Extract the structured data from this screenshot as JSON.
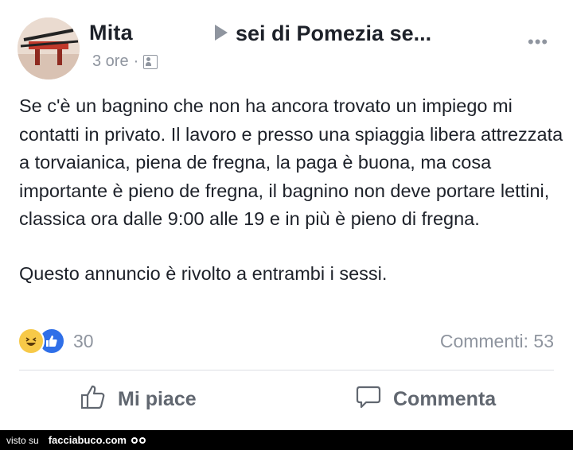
{
  "post": {
    "author": "Mita",
    "group": "sei di Pomezia se...",
    "time": "3 ore",
    "separator": "·",
    "audience_icon": "group-audience-icon",
    "more_label": "•••",
    "body_paragraphs": [
      "Se c'è un bagnino che non ha ancora trovato un impiego mi contatti in privato. Il lavoro e presso una spiaggia libera attrezzata a torvaianica, piena de fregna, la paga è buona, ma cosa importante è pieno de fregna, il bagnino non deve portare lettini,  classica ora dalle 9:00 alle 19 e in più è pieno di fregna.",
      "Questo annuncio è rivolto a entrambi i sessi."
    ]
  },
  "reactions": {
    "icons": [
      "haha-icon",
      "like-icon"
    ],
    "count": "30"
  },
  "comments": {
    "label": "Commenti: 53"
  },
  "actions": {
    "like_label": "Mi piace",
    "comment_label": "Commenta"
  },
  "footer": {
    "visto_su": "visto su",
    "site": "facciabuco.com"
  },
  "colors": {
    "text": "#1d2129",
    "muted": "#8f959f",
    "action": "#616770",
    "like_blue": "#2f6fe8",
    "haha_yellow": "#f7c948",
    "footer_bg": "#000000"
  }
}
